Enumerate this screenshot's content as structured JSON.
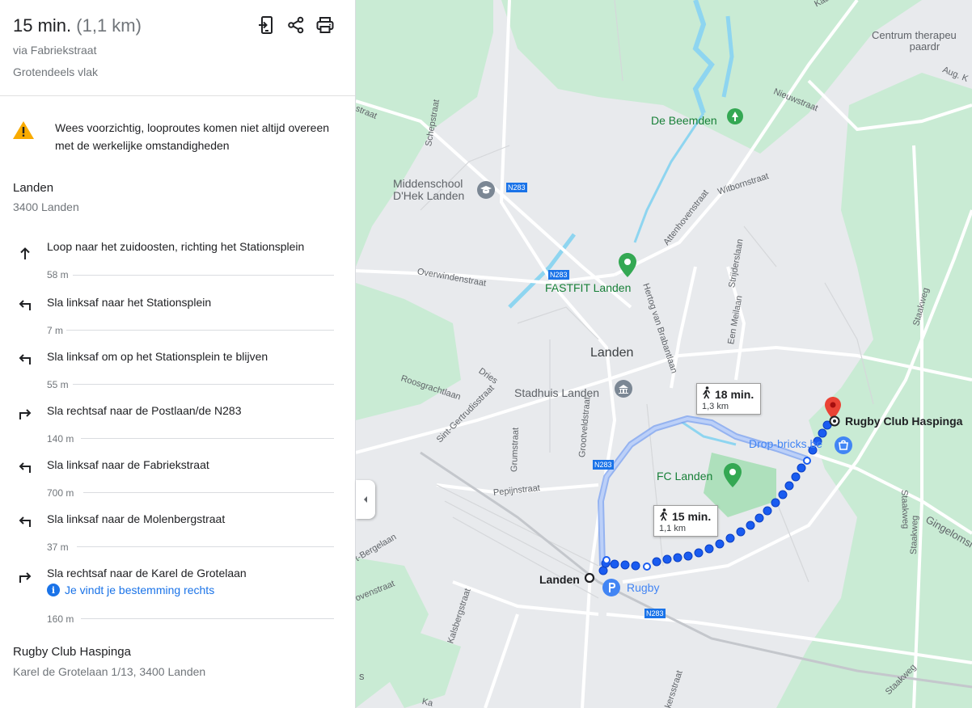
{
  "header": {
    "duration": "15 min.",
    "distance": "(1,1 km)",
    "via": "via Fabriekstraat",
    "terrain": "Grotendeels vlak",
    "icons": [
      "send-to-phone-icon",
      "share-icon",
      "print-icon"
    ]
  },
  "warning": {
    "icon": "warning-triangle-icon",
    "text": "Wees voorzichtig, looproutes komen niet altijd overeen met de werkelijke omstandigheden"
  },
  "origin": {
    "name": "Landen",
    "address": "3400 Landen"
  },
  "steps": [
    {
      "icon": "arrow-up-icon",
      "instruction": "Loop naar het zuidoosten, richting het Stationsplein",
      "distance": "58 m"
    },
    {
      "icon": "turn-left-icon",
      "instruction": "Sla linksaf naar het Stationsplein",
      "distance": "7 m"
    },
    {
      "icon": "turn-left-icon",
      "instruction": "Sla linksaf om op het Stationsplein te blijven",
      "distance": "55 m"
    },
    {
      "icon": "turn-right-icon",
      "instruction": "Sla rechtsaf naar de Postlaan/de N283",
      "distance": "140 m"
    },
    {
      "icon": "turn-left-icon",
      "instruction": "Sla linksaf naar de Fabriekstraat",
      "distance": "700 m"
    },
    {
      "icon": "turn-left-icon",
      "instruction": "Sla linksaf naar de Molenbergstraat",
      "distance": "37 m"
    },
    {
      "icon": "turn-right-icon",
      "instruction": "Sla rechtsaf naar de Karel de Grotelaan",
      "info": "Je vindt je bestemming rechts",
      "distance": "160 m"
    }
  ],
  "destination": {
    "name": "Rugby Club Haspinga",
    "address": "Karel de Grotelaan 1/13, 3400 Landen"
  },
  "map": {
    "places": {
      "de_beemden": "De Beemden",
      "middenschool_1": "Middenschool",
      "middenschool_2": "D'Hek Landen",
      "fastfit": "FASTFIT Landen",
      "landen": "Landen",
      "stadhuis": "Stadhuis Landen",
      "fc_landen": "FC Landen",
      "drop_bricks": "Drop-bricks.be",
      "rugby_club": "Rugby Club Haspinga",
      "start_landen": "Landen",
      "rugby": "Rugby",
      "centrum_1": "Centrum therapeu",
      "centrum_2": "paardr"
    },
    "streets": {
      "kaass": "Kaass",
      "nieuwstraat": "Nieuwstraat",
      "witbornstraat": "Witbornstraat",
      "attenhovenstraat": "Attenhovenstraat",
      "overwindenstraat": "Overwindenstraat",
      "schepstraat": "Schepstraat",
      "straat": "straat",
      "hertog": "Hertog van Brabantlaan",
      "strijdersplaan": "Strijderslaan",
      "eenmeilaan": "Een Meilaan",
      "dries": "Dries",
      "roosgrachtlaan": "Roosgrachtlaan",
      "sint_gertrudis": "Sint-Gertrudisstraat",
      "grumstraat": "Grumstraat",
      "grootveldstraat": "Grootveldstraat",
      "pepijnstraat": "Pepijnstraat",
      "bergelaan": "t-Bergelaan",
      "ovenstraat": "ovenstraat",
      "kalsbergstraat": "Kalsbergstraat",
      "staakweg_1": "Staakweg",
      "staakweg_2": "Staakweg",
      "staakweg_3": "Staakweg",
      "staakweg_4": "Staakweg",
      "gingelom": "Gingelomsi",
      "aug": "Aug. K",
      "kersstraat": "kersstraat",
      "s": "s",
      "ka": "Ka"
    },
    "road_badges": [
      "N283",
      "N283",
      "N283",
      "N283"
    ],
    "route_main": {
      "time": "15 min.",
      "dist": "1,1 km"
    },
    "route_alt": {
      "time": "18 min.",
      "dist": "1,3 km"
    }
  },
  "colors": {
    "route_blue": "#1a5cf0",
    "alt_route": "#a9c1f5",
    "pin_red": "#ea4335",
    "park_green": "#34a853",
    "water": "#8ed5f0",
    "grass": "#c9ebd4"
  }
}
